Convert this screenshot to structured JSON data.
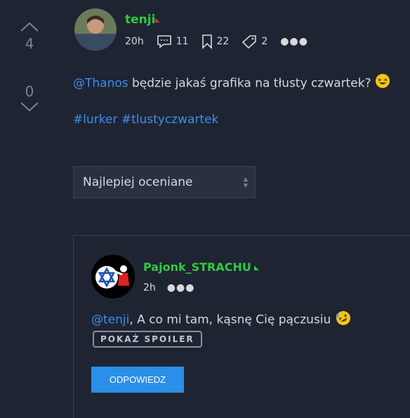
{
  "votes": {
    "up_count": "4",
    "down_count": "0"
  },
  "post": {
    "author": "tenji",
    "time": "20h",
    "comments": "11",
    "favorites": "22",
    "tags_count": "2",
    "mention": "@Thanos",
    "text": " będzie jakaś grafika na tłusty czwartek? ",
    "tags": [
      "#lurker",
      "#tlustyczwartek"
    ]
  },
  "sort": {
    "selected": "Najlepiej oceniane"
  },
  "comment": {
    "author": "Pajonk_STRACHU",
    "time": "2h",
    "mention": "@tenji",
    "text": ", A co mi tam, kąsnę Cię pączusiu ",
    "spoiler_label": "POKAŻ SPOILER",
    "reply_label": "ODPOWIEDZ"
  },
  "colors": {
    "username": "#2ecc40",
    "link": "#3d8ef0",
    "button": "#2b8ee8",
    "background": "#1f2432"
  }
}
